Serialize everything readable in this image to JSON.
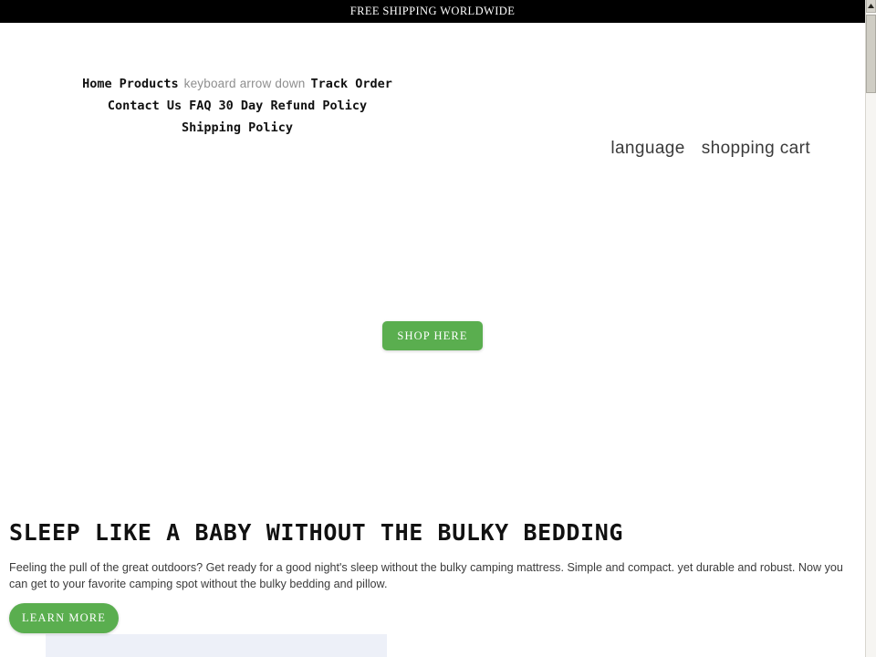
{
  "announcement": {
    "text": "FREE SHIPPING WORLDWIDE",
    "background": "#000000",
    "color": "#ffffff"
  },
  "header": {
    "nav": {
      "line1": [
        {
          "label": "Home",
          "kind": "link"
        },
        {
          "label": "Products",
          "kind": "link"
        },
        {
          "label": "keyboard arrow down",
          "kind": "icon-text"
        },
        {
          "label": "Track Order",
          "kind": "link"
        }
      ],
      "line2": [
        {
          "label": "Contact Us",
          "kind": "link"
        },
        {
          "label": "FAQ",
          "kind": "link"
        },
        {
          "label": "30 Day Refund Policy",
          "kind": "link"
        }
      ],
      "line3": [
        {
          "label": "Shipping Policy",
          "kind": "link"
        }
      ]
    },
    "utility": {
      "language_label": "language",
      "cart_label": "shopping cart"
    }
  },
  "hero": {
    "cta_label": "SHOP HERE",
    "cta_color": "#5aae4f"
  },
  "feature": {
    "heading": "SLEEP LIKE A BABY WITHOUT THE BULKY BEDDING",
    "paragraph": "Feeling the pull of the great outdoors? Get ready for a good night's sleep without the bulky camping mattress. Simple and compact. yet durable and robust. Now you can get to your favorite camping spot without the bulky bedding and pillow.",
    "cta_label": "LEARN MORE",
    "cta_color": "#5aae4f",
    "media_placeholder_color": "#edf0f8"
  },
  "scrollbar": {
    "up_arrow": "scroll-up"
  }
}
